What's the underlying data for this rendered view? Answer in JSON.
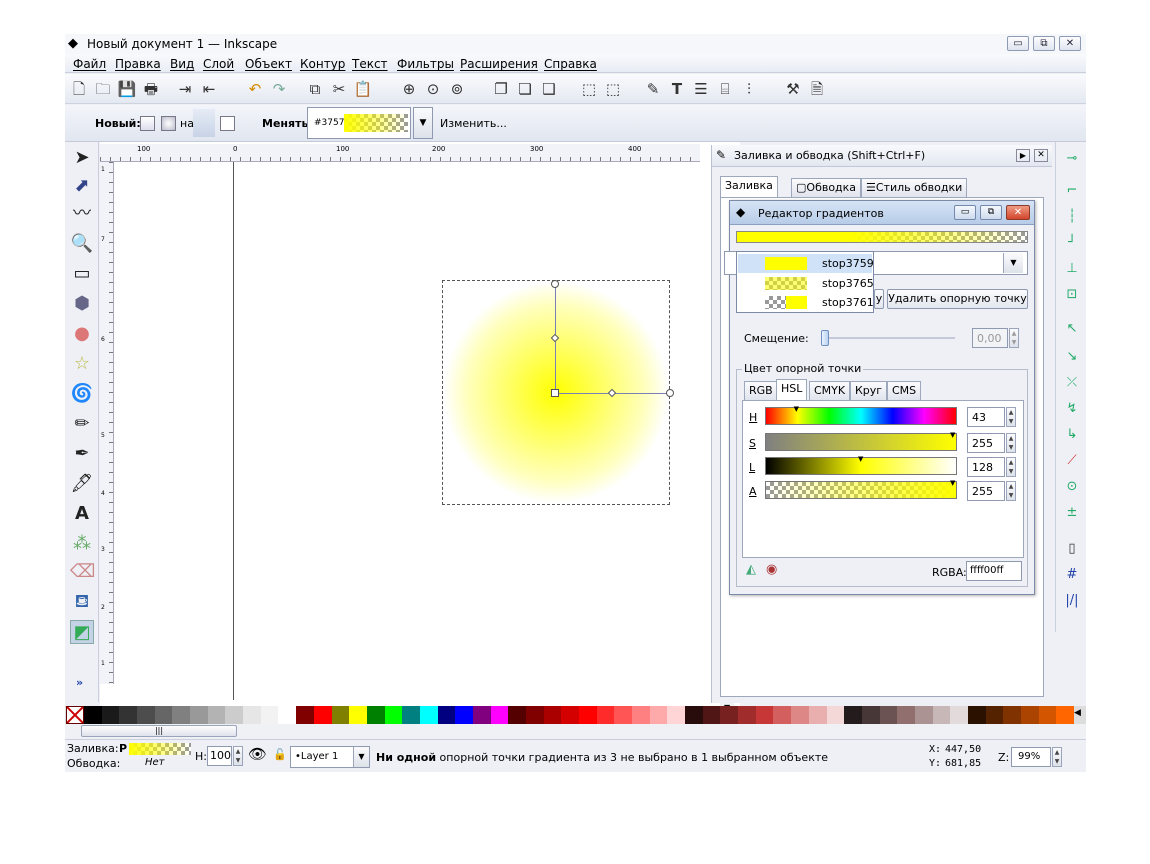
{
  "window": {
    "title": "Новый документ 1 — Inkscape",
    "min_label": "▭",
    "max_label": "⧉",
    "close_label": "✕"
  },
  "menu": [
    "Файл",
    "Правка",
    "Вид",
    "Слой",
    "Объект",
    "Контур",
    "Текст",
    "Фильтры",
    "Расширения",
    "Справка"
  ],
  "controls": {
    "new_label": "Новый:",
    "on_label": "на",
    "change_label": "Менять:",
    "gradient_name": "#3757",
    "edit_label": "Изменить..."
  },
  "ruler_labels": [
    "100",
    "0",
    "100",
    "200",
    "300",
    "400"
  ],
  "ruler_v_labels": [
    "1",
    "7",
    "6",
    "5",
    "4",
    "3",
    "2",
    "1"
  ],
  "fill_stroke": {
    "title": "Заливка и обводка (Shift+Ctrl+F)",
    "tabs": [
      "Заливка",
      "Обводка",
      "Стиль обводки"
    ]
  },
  "gradient_editor": {
    "title": "Редактор градиентов",
    "stops": [
      {
        "name": "stop3759",
        "selected": true
      },
      {
        "name": "stop3765",
        "selected": false
      },
      {
        "name": "stop3761",
        "selected": false
      }
    ],
    "delete_stop_label": "Удалить опорную точку",
    "offset_label": "Смещение:",
    "offset_value": "0,00",
    "stop_color_label": "Цвет опорной точки",
    "color_tabs": [
      "RGB",
      "HSL",
      "CMYK",
      "Круг",
      "CMS"
    ],
    "active_color_tab": "HSL",
    "channels": [
      {
        "label": "H",
        "value": "43",
        "fraction": 0.15
      },
      {
        "label": "S",
        "value": "255",
        "fraction": 1.0
      },
      {
        "label": "L",
        "value": "128",
        "fraction": 0.5
      },
      {
        "label": "A",
        "value": "255",
        "fraction": 1.0
      }
    ],
    "rgba_label": "RGBA:",
    "rgba_value": "ffff00ff"
  },
  "status": {
    "fill_label": "Заливка:",
    "stroke_label": "Обводка:",
    "fill_type": "Р",
    "stroke_value": "Нет",
    "h_label": "Н:",
    "h_value": "100",
    "layer_value": "•Layer 1",
    "message_bold": "Ни одной",
    "message_rest": " опорной точки градиента из 3 не выбрано в 1 выбранном объекте",
    "x_label": "X:",
    "x_value": "447,50",
    "y_label": "Y:",
    "y_value": "681,85",
    "z_label": "Z:",
    "zoom_value": "99%"
  },
  "palette_colors": [
    "#000000",
    "#1a1a1a",
    "#333333",
    "#4d4d4d",
    "#666666",
    "#808080",
    "#999999",
    "#b3b3b3",
    "#cccccc",
    "#e6e6e6",
    "#f2f2f2",
    "#ffffff",
    "#800000",
    "#ff0000",
    "#808000",
    "#ffff00",
    "#008000",
    "#00ff00",
    "#008080",
    "#00ffff",
    "#000080",
    "#0000ff",
    "#800080",
    "#ff00ff",
    "#550000",
    "#800000",
    "#aa0000",
    "#d40000",
    "#ff0000",
    "#ff2a2a",
    "#ff5555",
    "#ff8080",
    "#ffaaaa",
    "#ffd5d5",
    "#280b0b",
    "#501616",
    "#782121",
    "#a02c2c",
    "#c83737",
    "#d35f5f",
    "#de8787",
    "#e9afaf",
    "#f4d7d7",
    "#241c1c",
    "#483737",
    "#6c5353",
    "#916f6f",
    "#ac9393",
    "#c8b7b7",
    "#e3dbdb",
    "#2b1100",
    "#552200",
    "#803300",
    "#aa4400",
    "#d45500",
    "#ff6600"
  ],
  "colors": {
    "accent_yellow": "#ffff00",
    "selection_blue": "#cfe2f8"
  }
}
